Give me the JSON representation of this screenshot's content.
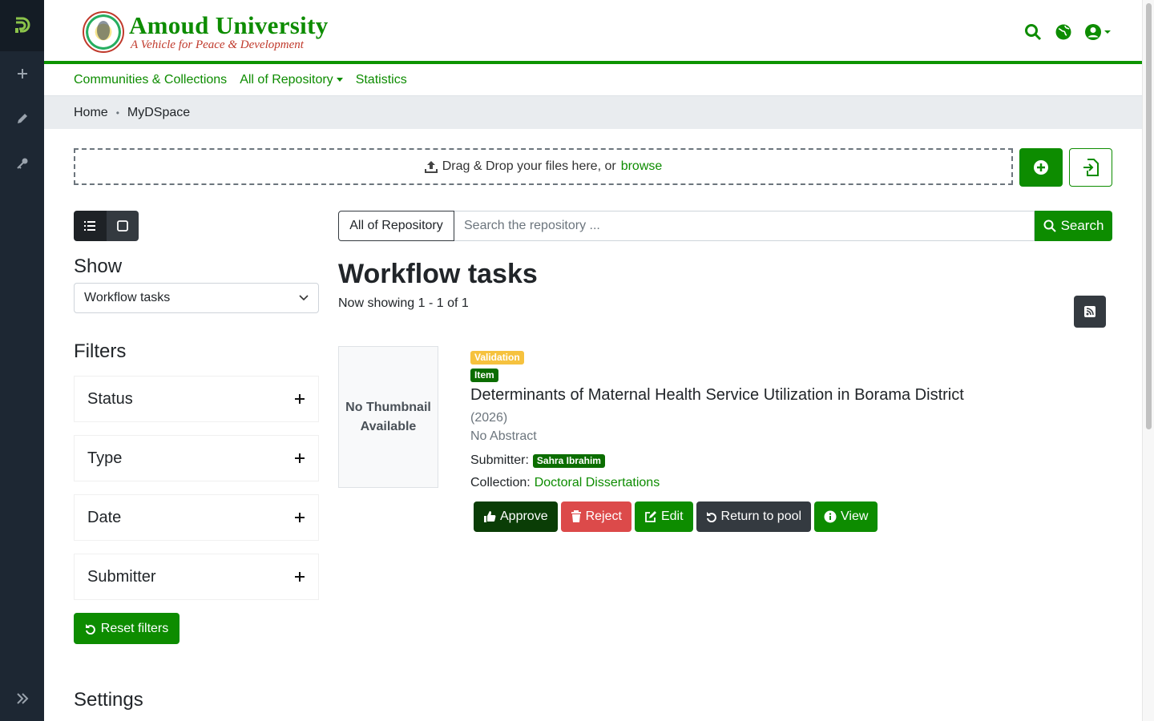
{
  "brand": {
    "name": "Amoud University",
    "tagline": "A Vehicle for Peace & Development",
    "seal_text": "HAMARGABA CENTER · AMOUD UNIVERSITY"
  },
  "nav": {
    "communities": "Communities & Collections",
    "all_repository": "All of Repository",
    "statistics": "Statistics"
  },
  "breadcrumb": {
    "home": "Home",
    "separator": "•",
    "current": "MyDSpace"
  },
  "upload": {
    "text": "Drag & Drop your files here, or",
    "browse": "browse"
  },
  "sidebar": {
    "show_title": "Show",
    "show_value": "Workflow tasks",
    "filters_title": "Filters",
    "filters": [
      "Status",
      "Type",
      "Date",
      "Submitter"
    ],
    "reset_label": "Reset filters",
    "settings_title": "Settings"
  },
  "search": {
    "scope": "All of Repository",
    "placeholder": "Search the repository ...",
    "button": "Search"
  },
  "results": {
    "title": "Workflow tasks",
    "showing": "Now showing 1 - 1 of 1"
  },
  "item": {
    "thumbnail": "No Thumbnail Available",
    "badge_status": "Validation",
    "badge_type": "Item",
    "title": "Determinants of Maternal Health Service Utilization in Borama District",
    "date": "(2026)",
    "abstract": "No Abstract",
    "submitter_label": "Submitter:",
    "submitter": "Sahra Ibrahim",
    "collection_label": "Collection:",
    "collection": "Doctoral Dissertations"
  },
  "actions": {
    "approve": "Approve",
    "reject": "Reject",
    "edit": "Edit",
    "return_pool": "Return to pool",
    "view": "View"
  },
  "colors": {
    "brand_green": "#0d8c00",
    "sidebar_dark": "#1d2733",
    "warning": "#f6c23e",
    "danger": "#dc4a4a"
  }
}
